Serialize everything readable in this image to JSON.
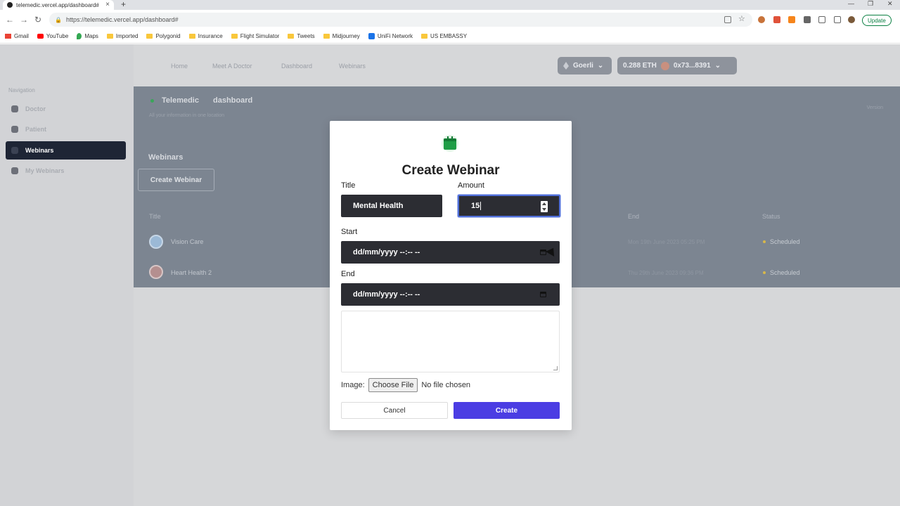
{
  "browser": {
    "tab_title": "telemedic.vercel.app/dashboard#",
    "url": "https://telemedic.vercel.app/dashboard#",
    "update_label": "Update",
    "bookmarks": [
      "Gmail",
      "YouTube",
      "Maps",
      "Imported",
      "Polygonid",
      "Insurance",
      "Flight Simulator",
      "Tweets",
      "Midjourney",
      "UniFi Network",
      "US EMBASSY"
    ]
  },
  "topnav": {
    "links": [
      "Home",
      "Meet A Doctor",
      "Dashboard",
      "Webinars"
    ],
    "network": "Goerli",
    "balance": "0.288 ETH",
    "account": "0x73...8391"
  },
  "sidebar": {
    "heading": "Navigation",
    "items": [
      {
        "label": "Doctor"
      },
      {
        "label": "Patient"
      },
      {
        "label": "Webinars"
      },
      {
        "label": "My Webinars"
      }
    ]
  },
  "content": {
    "brand": "Telemedic",
    "page": "dashboard",
    "subtitle": "All your information in one location",
    "version": "Version",
    "section_title": "Webinars",
    "create_button": "Create Webinar",
    "columns": {
      "title": "Title",
      "end": "End",
      "status": "Status"
    },
    "rows": [
      {
        "title": "Vision Care",
        "end": "Mon 19th June 2023 05:25 PM",
        "status": "Scheduled"
      },
      {
        "title": "Heart Health 2",
        "end": "Thu 29th June 2023 09:36 PM",
        "status": "Scheduled"
      }
    ]
  },
  "modal": {
    "title": "Create Webinar",
    "title_label": "Title",
    "title_value": "Mental Health",
    "amount_label": "Amount",
    "amount_value": "15",
    "start_label": "Start",
    "start_placeholder": "dd/mm/yyyy --:-- --",
    "end_label": "End",
    "end_placeholder": "dd/mm/yyyy --:-- --",
    "image_label": "Image:",
    "choose_file": "Choose File",
    "no_file": "No file chosen",
    "cancel": "Cancel",
    "create": "Create"
  },
  "colors": {
    "primary_button": "#4b3de3",
    "sidebar_active": "#1e2535",
    "calendar_green": "#1f9d46"
  }
}
